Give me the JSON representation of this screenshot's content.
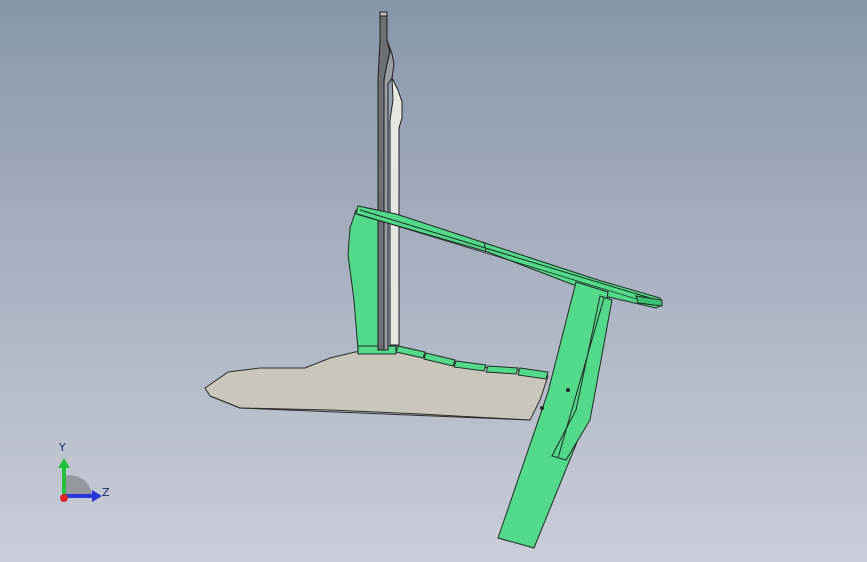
{
  "viewport": {
    "background_top": "#8797aa",
    "background_bottom": "#c9ced8"
  },
  "model": {
    "part_color": "#52d98a",
    "base_color": "#c9c7bc",
    "edge_color": "#1f2a22"
  },
  "triad": {
    "y_label": "Y",
    "z_label": "Z",
    "y_axis_color": "#22c33a",
    "z_axis_color": "#2338d6",
    "origin_color": "#e0222a"
  }
}
